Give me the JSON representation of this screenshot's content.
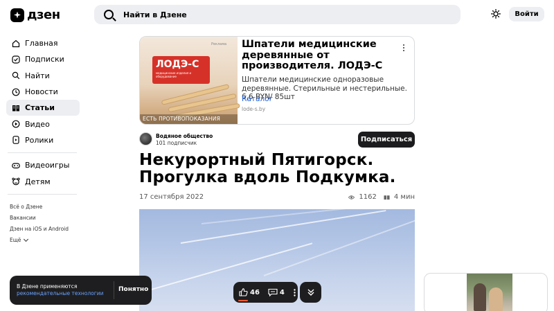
{
  "header": {
    "logo_text": "дзен",
    "search_placeholder": "Найти в Дзене",
    "login_label": "Войти"
  },
  "sidebar": {
    "items": [
      {
        "label": "Главная",
        "icon": "home-icon",
        "active": false
      },
      {
        "label": "Подписки",
        "icon": "subscriptions-icon",
        "active": false
      },
      {
        "label": "Найти",
        "icon": "search-icon",
        "active": false
      },
      {
        "label": "Новости",
        "icon": "news-icon",
        "active": false
      },
      {
        "label": "Статьи",
        "icon": "articles-icon",
        "active": true
      },
      {
        "label": "Видео",
        "icon": "video-icon",
        "active": false
      },
      {
        "label": "Ролики",
        "icon": "shorts-icon",
        "active": false
      },
      {
        "label": "Видеоигры",
        "icon": "gamepad-icon",
        "active": false
      },
      {
        "label": "Детям",
        "icon": "kids-icon",
        "active": false
      }
    ],
    "footer_links": [
      "Всё о Дзене",
      "Вакансии",
      "Дзен на iOS и Android"
    ],
    "more_label": "Ещё"
  },
  "ad": {
    "image_logo": "ЛОДЭ-С",
    "image_logo_sub": "медицинские изделия и оборудование",
    "image_badge": "Реклама",
    "image_warning": "ЕСТЬ ПРОТИВОПОКАЗАНИЯ",
    "title": "Шпатели медицинские деревянные от производителя. ЛОДЭ-С",
    "description": "Шпатели медицинские одноразовые деревянные. Стерильные и нестерильные. 6,6 BYN/ 85шт",
    "link_label": "Каталог",
    "domain": "lode-s.by"
  },
  "author": {
    "name": "Водяное общество",
    "subscribers": "101 подписчик",
    "subscribe_label": "Подписаться"
  },
  "article": {
    "title": "Некурортный Пятигорск. Прогулка вдоль Подкумка.",
    "date": "17 сентября 2022",
    "views": "1162",
    "read_time": "4 мин"
  },
  "cookie": {
    "text": "В Дзене применяются",
    "link": "рекомендательные технологии",
    "button": "Понятно"
  },
  "actions": {
    "likes": "46",
    "comments": "4"
  },
  "colors": {
    "accent_link": "#2563d9",
    "dark_button": "#1c1c1e",
    "sidebar_active": "#edeef1",
    "like_indicator": "#ff5b33"
  }
}
